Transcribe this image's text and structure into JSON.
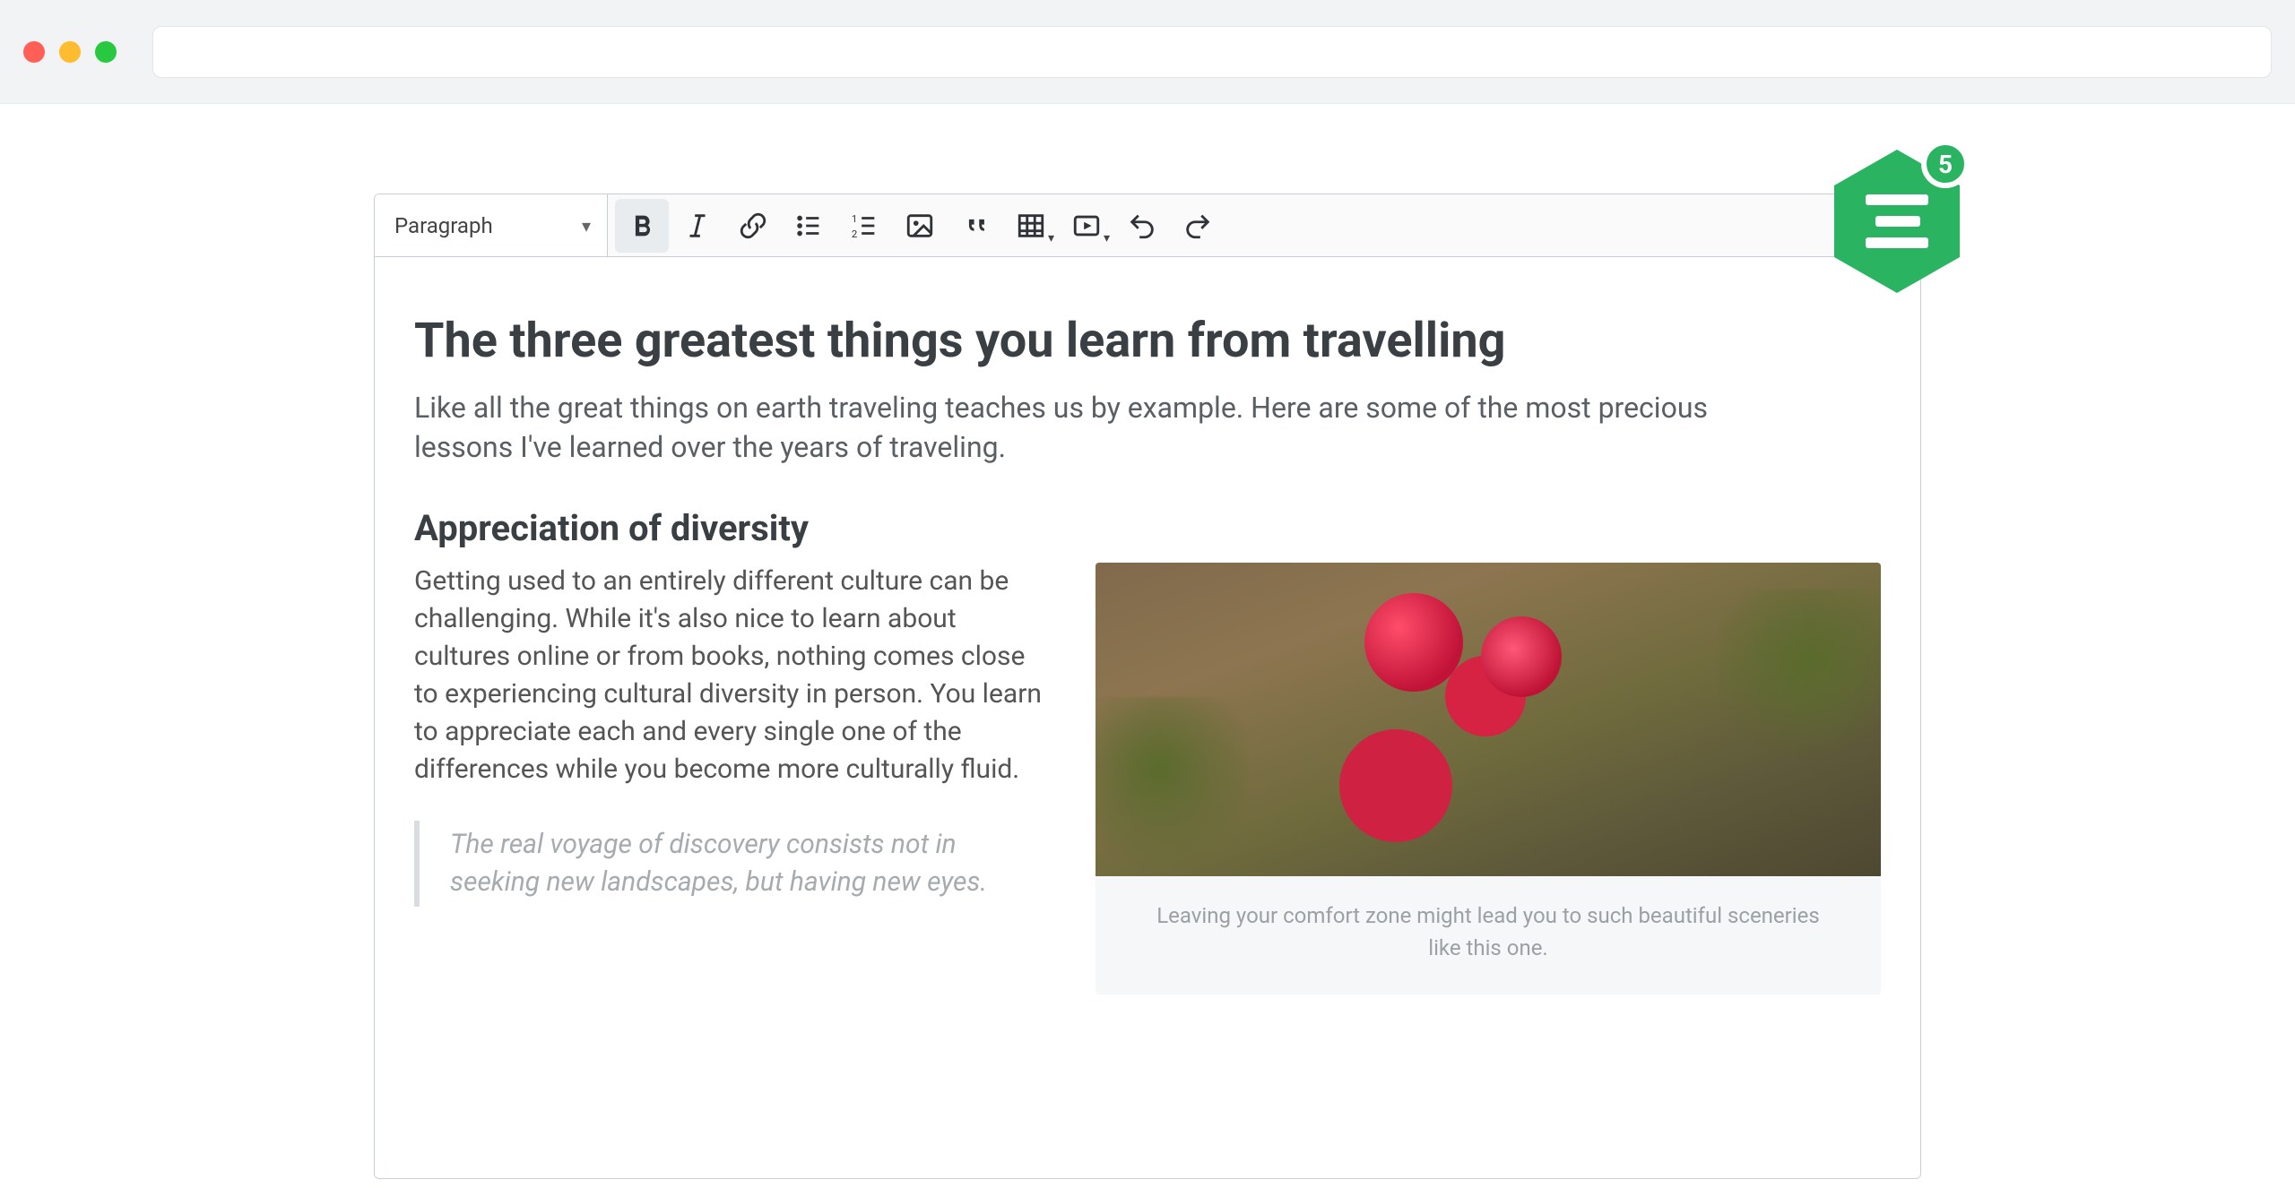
{
  "toolbar": {
    "style_selector": "Paragraph",
    "buttons": {
      "bold": "bold-icon",
      "italic": "italic-icon",
      "link": "link-icon",
      "ul": "bulleted-list-icon",
      "ol": "numbered-list-icon",
      "image": "image-icon",
      "quote": "blockquote-icon",
      "table": "table-icon",
      "media": "media-icon",
      "undo": "undo-icon",
      "redo": "redo-icon"
    }
  },
  "doc": {
    "title": "The three greatest things you learn from travelling",
    "lead": "Like all the great things on earth traveling teaches us by example. Here are some of the most precious lessons I've learned over the years of traveling.",
    "section1_heading": "Appreciation of diversity",
    "section1_body": "Getting used to an entirely different culture can be challenging. While it's also nice to learn about cultures online or from books, nothing comes close to experiencing cultural diversity in person. You learn to appreciate each and every single one of the differences while you become more culturally fluid.",
    "quote": "The real voyage of discovery consists not in seeking new landscapes, but having new eyes.",
    "figure_caption": "Leaving your comfort zone might lead you to such beautiful sceneries like this one."
  },
  "badge": {
    "count": "5"
  },
  "colors": {
    "accent": "#2ab461",
    "toolbar_border": "#c9ced4"
  }
}
